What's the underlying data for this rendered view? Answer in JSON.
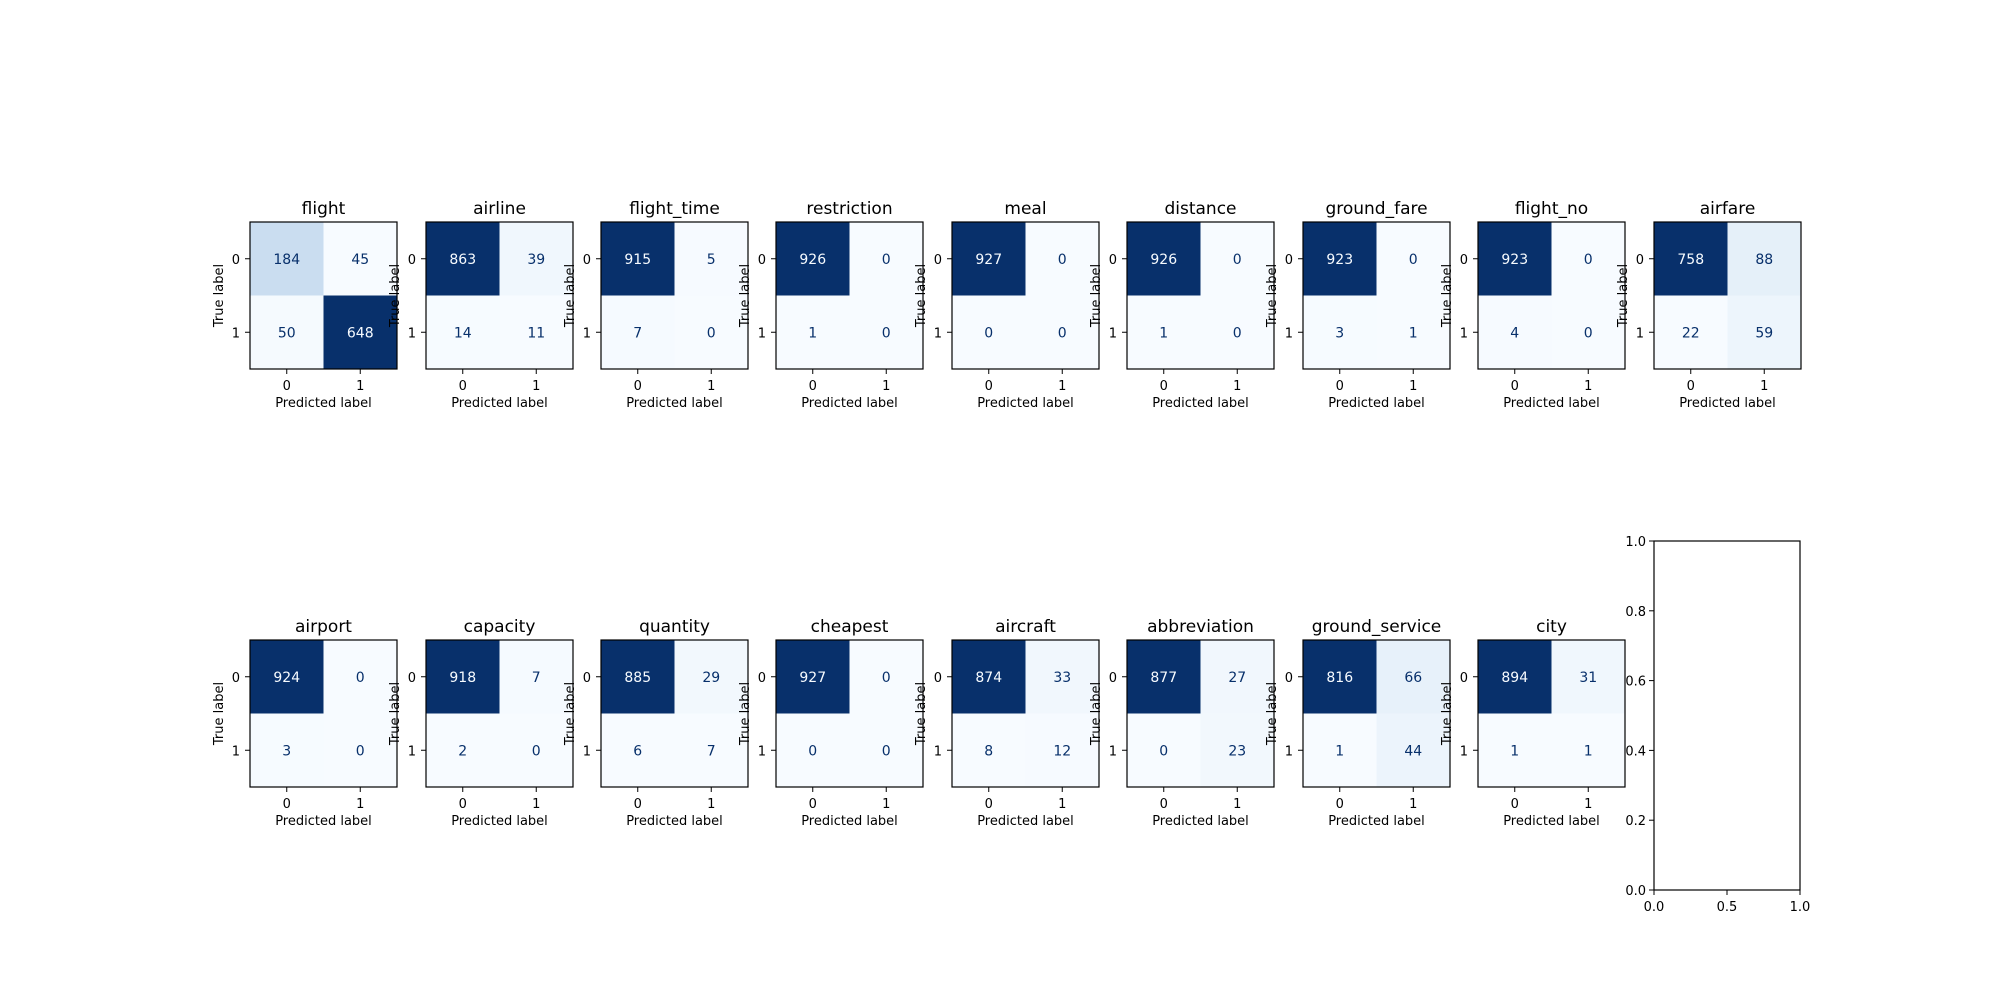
{
  "chart_data": [
    {
      "type": "heatmap",
      "title": "flight",
      "xlabel": "Predicted label",
      "ylabel": "True label",
      "x_ticks": [
        "0",
        "1"
      ],
      "y_ticks": [
        "0",
        "1"
      ],
      "colormap": "Blues",
      "values": [
        [
          184,
          45
        ],
        [
          50,
          648
        ]
      ]
    },
    {
      "type": "heatmap",
      "title": "airline",
      "xlabel": "Predicted label",
      "ylabel": "True label",
      "x_ticks": [
        "0",
        "1"
      ],
      "y_ticks": [
        "0",
        "1"
      ],
      "colormap": "Blues",
      "values": [
        [
          863,
          39
        ],
        [
          14,
          11
        ]
      ]
    },
    {
      "type": "heatmap",
      "title": "flight_time",
      "xlabel": "Predicted label",
      "ylabel": "True label",
      "x_ticks": [
        "0",
        "1"
      ],
      "y_ticks": [
        "0",
        "1"
      ],
      "colormap": "Blues",
      "values": [
        [
          915,
          5
        ],
        [
          7,
          0
        ]
      ]
    },
    {
      "type": "heatmap",
      "title": "restriction",
      "xlabel": "Predicted label",
      "ylabel": "True label",
      "x_ticks": [
        "0",
        "1"
      ],
      "y_ticks": [
        "0",
        "1"
      ],
      "colormap": "Blues",
      "values": [
        [
          926,
          0
        ],
        [
          1,
          0
        ]
      ]
    },
    {
      "type": "heatmap",
      "title": "meal",
      "xlabel": "Predicted label",
      "ylabel": "True label",
      "x_ticks": [
        "0",
        "1"
      ],
      "y_ticks": [
        "0",
        "1"
      ],
      "colormap": "Blues",
      "values": [
        [
          927,
          0
        ],
        [
          0,
          0
        ]
      ]
    },
    {
      "type": "heatmap",
      "title": "distance",
      "xlabel": "Predicted label",
      "ylabel": "True label",
      "x_ticks": [
        "0",
        "1"
      ],
      "y_ticks": [
        "0",
        "1"
      ],
      "colormap": "Blues",
      "values": [
        [
          926,
          0
        ],
        [
          1,
          0
        ]
      ]
    },
    {
      "type": "heatmap",
      "title": "ground_fare",
      "xlabel": "Predicted label",
      "ylabel": "True label",
      "x_ticks": [
        "0",
        "1"
      ],
      "y_ticks": [
        "0",
        "1"
      ],
      "colormap": "Blues",
      "values": [
        [
          923,
          0
        ],
        [
          3,
          1
        ]
      ]
    },
    {
      "type": "heatmap",
      "title": "flight_no",
      "xlabel": "Predicted label",
      "ylabel": "True label",
      "x_ticks": [
        "0",
        "1"
      ],
      "y_ticks": [
        "0",
        "1"
      ],
      "colormap": "Blues",
      "values": [
        [
          923,
          0
        ],
        [
          4,
          0
        ]
      ]
    },
    {
      "type": "heatmap",
      "title": "airfare",
      "xlabel": "Predicted label",
      "ylabel": "True label",
      "x_ticks": [
        "0",
        "1"
      ],
      "y_ticks": [
        "0",
        "1"
      ],
      "colormap": "Blues",
      "values": [
        [
          758,
          88
        ],
        [
          22,
          59
        ]
      ]
    },
    {
      "type": "heatmap",
      "title": "airport",
      "xlabel": "Predicted label",
      "ylabel": "True label",
      "x_ticks": [
        "0",
        "1"
      ],
      "y_ticks": [
        "0",
        "1"
      ],
      "colormap": "Blues",
      "values": [
        [
          924,
          0
        ],
        [
          3,
          0
        ]
      ]
    },
    {
      "type": "heatmap",
      "title": "capacity",
      "xlabel": "Predicted label",
      "ylabel": "True label",
      "x_ticks": [
        "0",
        "1"
      ],
      "y_ticks": [
        "0",
        "1"
      ],
      "colormap": "Blues",
      "values": [
        [
          918,
          7
        ],
        [
          2,
          0
        ]
      ]
    },
    {
      "type": "heatmap",
      "title": "quantity",
      "xlabel": "Predicted label",
      "ylabel": "True label",
      "x_ticks": [
        "0",
        "1"
      ],
      "y_ticks": [
        "0",
        "1"
      ],
      "colormap": "Blues",
      "values": [
        [
          885,
          29
        ],
        [
          6,
          7
        ]
      ]
    },
    {
      "type": "heatmap",
      "title": "cheapest",
      "xlabel": "Predicted label",
      "ylabel": "True label",
      "x_ticks": [
        "0",
        "1"
      ],
      "y_ticks": [
        "0",
        "1"
      ],
      "colormap": "Blues",
      "values": [
        [
          927,
          0
        ],
        [
          0,
          0
        ]
      ]
    },
    {
      "type": "heatmap",
      "title": "aircraft",
      "xlabel": "Predicted label",
      "ylabel": "True label",
      "x_ticks": [
        "0",
        "1"
      ],
      "y_ticks": [
        "0",
        "1"
      ],
      "colormap": "Blues",
      "values": [
        [
          874,
          33
        ],
        [
          8,
          12
        ]
      ]
    },
    {
      "type": "heatmap",
      "title": "abbreviation",
      "xlabel": "Predicted label",
      "ylabel": "True label",
      "x_ticks": [
        "0",
        "1"
      ],
      "y_ticks": [
        "0",
        "1"
      ],
      "colormap": "Blues",
      "values": [
        [
          877,
          27
        ],
        [
          0,
          23
        ]
      ]
    },
    {
      "type": "heatmap",
      "title": "ground_service",
      "xlabel": "Predicted label",
      "ylabel": "True label",
      "x_ticks": [
        "0",
        "1"
      ],
      "y_ticks": [
        "0",
        "1"
      ],
      "colormap": "Blues",
      "values": [
        [
          816,
          66
        ],
        [
          1,
          44
        ]
      ]
    },
    {
      "type": "heatmap",
      "title": "city",
      "xlabel": "Predicted label",
      "ylabel": "True label",
      "x_ticks": [
        "0",
        "1"
      ],
      "y_ticks": [
        "0",
        "1"
      ],
      "colormap": "Blues",
      "values": [
        [
          894,
          31
        ],
        [
          1,
          1
        ]
      ]
    },
    {
      "type": "line",
      "title": "",
      "xlim": [
        0,
        1
      ],
      "ylim": [
        0,
        1
      ],
      "x_ticks": [
        "0.0",
        "0.5",
        "1.0"
      ],
      "y_ticks": [
        "0.0",
        "0.2",
        "0.4",
        "0.6",
        "0.8",
        "1.0"
      ],
      "series": []
    }
  ]
}
